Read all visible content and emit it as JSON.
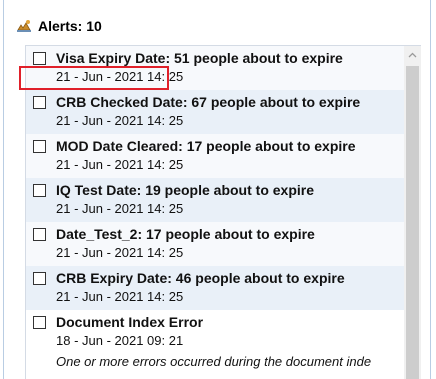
{
  "header": {
    "title": "Alerts: 10",
    "icon": "alerts-icon"
  },
  "alerts": [
    {
      "title": "Visa Expiry Date: 51 people about to expire",
      "date": "21 - Jun - 2021 14: 25"
    },
    {
      "title": "CRB Checked Date: 67 people about to expire",
      "date": "21 - Jun - 2021 14: 25"
    },
    {
      "title": "MOD Date Cleared: 17 people about to expire",
      "date": "21 - Jun - 2021 14: 25"
    },
    {
      "title": "IQ Test Date: 19 people about to expire",
      "date": "21 - Jun - 2021 14: 25"
    },
    {
      "title": "Date_Test_2: 17 people about to expire",
      "date": "21 - Jun - 2021 14: 25"
    },
    {
      "title": "CRB Expiry Date: 46 people about to expire",
      "date": "21 - Jun - 2021 14: 25"
    },
    {
      "title": "Document Index Error",
      "date": "18 - Jun - 2021 09: 21",
      "description": "One or more errors occurred during the document inde"
    }
  ],
  "colors": {
    "highlight": "#e0202a",
    "row_tint": "#e9f0f8",
    "border": "#b9cde3"
  }
}
